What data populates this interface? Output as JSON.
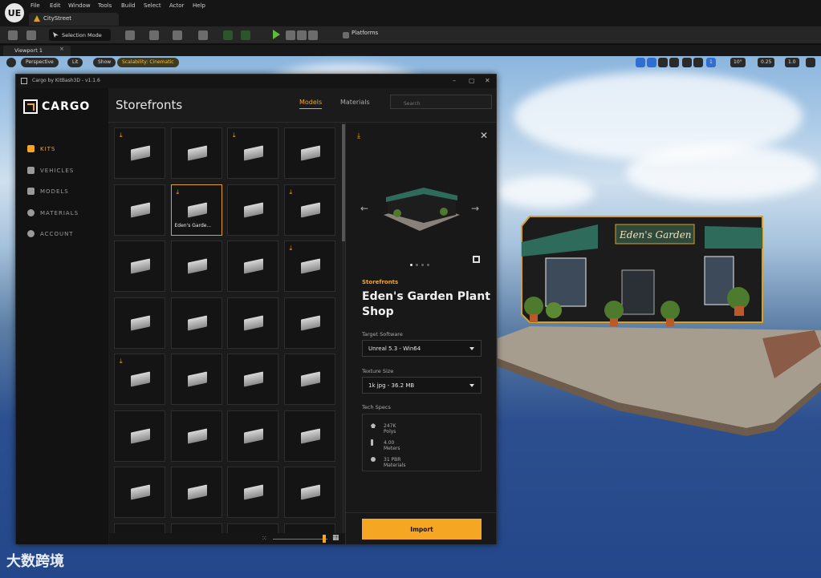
{
  "menu": {
    "items": [
      "File",
      "Edit",
      "Window",
      "Tools",
      "Build",
      "Select",
      "Actor",
      "Help"
    ],
    "level": "CityStreet",
    "logo": "UE"
  },
  "toolbar": {
    "selection_mode": "Selection Mode",
    "platforms": "Platforms"
  },
  "viewport": {
    "tab": "Viewport 1",
    "perspective": "Perspective",
    "lit": "Lit",
    "show": "Show",
    "scalability": "Scalability: Cinematic",
    "grid_value": "1",
    "angle_value": "10°",
    "scale_value": "0.25",
    "camera_value": "1.0"
  },
  "cargo": {
    "title": "Cargo by KitBash3D - v1.1.6",
    "logo": "CARGO",
    "nav": [
      {
        "label": "KITS",
        "active": true,
        "icon": "kits-icon"
      },
      {
        "label": "VEHICLES",
        "active": false,
        "icon": "vehicle-icon"
      },
      {
        "label": "MODELS",
        "active": false,
        "icon": "cube-icon"
      },
      {
        "label": "MATERIALS",
        "active": false,
        "icon": "sphere-icon"
      },
      {
        "label": "ACCOUNT",
        "active": false,
        "icon": "account-icon"
      }
    ],
    "heading": "Storefronts",
    "tabs": {
      "models": "Models",
      "materials": "Materials"
    },
    "search_placeholder": "Search",
    "grid": {
      "selected_label": "Eden's Garde...",
      "downloaded": [
        0,
        2,
        5,
        7,
        11,
        16
      ]
    },
    "detail": {
      "category": "Storefronts",
      "name": "Eden's Garden Plant Shop",
      "target_software_label": "Target Software",
      "target_software": "Unreal 5.3 - Win64",
      "texture_size_label": "Texture Size",
      "texture_size": "1k jpg - 36.2 MB",
      "tech_specs_label": "Tech Specs",
      "specs": [
        "247K Polys",
        "4.00 Meters",
        "31 PBR Materials"
      ],
      "import": "Import",
      "carousel_pages": 4,
      "carousel_active": 0
    }
  },
  "building": {
    "sign": "Eden's Garden"
  },
  "watermark": "大数跨境",
  "colors": {
    "accent": "#f5a623",
    "panel": "#1b1b1b",
    "sidebar": "#121212"
  }
}
